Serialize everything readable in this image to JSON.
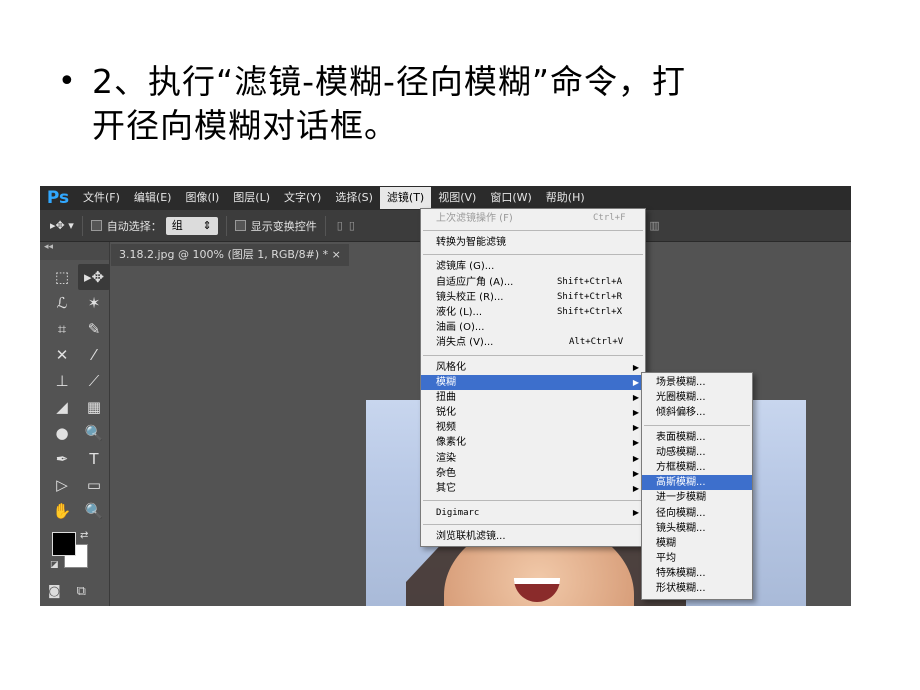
{
  "slide": {
    "bullet": "•",
    "line1": "2、执行“滤镜-模糊-径向模糊”命令，打",
    "line2": "开径向模糊对话框。"
  },
  "app": {
    "logo": "Ps",
    "menubar": [
      "文件(F)",
      "编辑(E)",
      "图像(I)",
      "图层(L)",
      "文字(Y)",
      "选择(S)",
      "滤镜(T)",
      "视图(V)",
      "窗口(W)",
      "帮助(H)"
    ],
    "active_menu": "滤镜(T)"
  },
  "options": {
    "move_icon": "▸✥ ▾",
    "auto_select_label": "自动选择：",
    "auto_select_value": "组",
    "transform_label": "显示变换控件"
  },
  "document": {
    "tab_title": "3.18.2.jpg @ 100% (图层 1, RGB/8#) * ×"
  },
  "toolbox": {
    "collapse": "◂◂",
    "tools": [
      "⬚",
      "▸✥",
      "ℒ",
      "✶",
      "⌗",
      "✎",
      "✕",
      "⁄",
      "⊥",
      "⟋",
      "◢",
      "▦",
      "●",
      "🔍",
      "✒",
      "T",
      "▷",
      "▭",
      "✋",
      "🔍"
    ],
    "swap": "⇄",
    "defaults": "◪",
    "mask_icons": [
      "◙",
      "⧉"
    ]
  },
  "filter_menu": {
    "last_filter": {
      "label": "上次滤镜操作 (F)",
      "shortcut": "Ctrl+F"
    },
    "smart": "转换为智能滤镜",
    "group1": [
      {
        "label": "滤镜库 (G)...",
        "shortcut": ""
      },
      {
        "label": "自适应广角 (A)...",
        "shortcut": "Shift+Ctrl+A"
      },
      {
        "label": "镜头校正 (R)...",
        "shortcut": "Shift+Ctrl+R"
      },
      {
        "label": "液化 (L)...",
        "shortcut": "Shift+Ctrl+X"
      },
      {
        "label": "油画 (O)...",
        "shortcut": ""
      },
      {
        "label": "消失点 (V)...",
        "shortcut": "Alt+Ctrl+V"
      }
    ],
    "submenus": [
      "风格化",
      "模糊",
      "扭曲",
      "锐化",
      "视频",
      "像素化",
      "渲染",
      "杂色",
      "其它"
    ],
    "highlighted": "模糊",
    "digimarc": "Digimarc",
    "browse": "浏览联机滤镜..."
  },
  "blur_menu": {
    "group1": [
      "场景模糊...",
      "光圈模糊...",
      "倾斜偏移..."
    ],
    "group2": [
      "表面模糊...",
      "动感模糊...",
      "方框模糊...",
      "高斯模糊...",
      "进一步模糊",
      "径向模糊...",
      "镜头模糊...",
      "模糊",
      "平均",
      "特殊模糊...",
      "形状模糊..."
    ],
    "highlighted": "高斯模糊..."
  },
  "colors": {
    "menu_highlight": "#3d6fcc",
    "ps_blue": "#31a8ff"
  }
}
